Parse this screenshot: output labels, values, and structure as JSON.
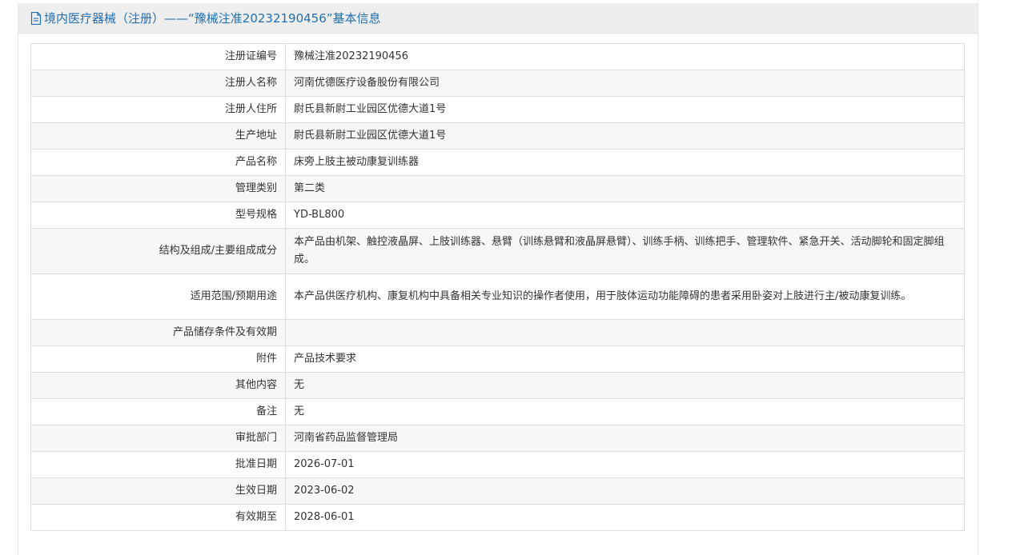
{
  "header": {
    "title": "境内医疗器械（注册）——“豫械注准20232190456”基本信息",
    "icon": "document-icon",
    "color": "#1f6fb2"
  },
  "rows": [
    {
      "label": "注册证编号",
      "value": "豫械注准20232190456"
    },
    {
      "label": "注册人名称",
      "value": "河南优德医疗设备股份有限公司"
    },
    {
      "label": "注册人住所",
      "value": "尉氏县新尉工业园区优德大道1号"
    },
    {
      "label": "生产地址",
      "value": "尉氏县新尉工业园区优德大道1号"
    },
    {
      "label": "产品名称",
      "value": "床旁上肢主被动康复训练器"
    },
    {
      "label": "管理类别",
      "value": "第二类"
    },
    {
      "label": "型号规格",
      "value": "YD-BL800"
    },
    {
      "label": "结构及组成/主要组成成分",
      "value": "本产品由机架、触控液晶屏、上肢训练器、悬臂（训练悬臂和液晶屏悬臂）、训练手柄、训练把手、管理软件、紧急开关、活动脚轮和固定脚组成。"
    },
    {
      "label": "适用范围/预期用途",
      "value": "本产品供医疗机构、康复机构中具备相关专业知识的操作者使用，用于肢体运动功能障碍的患者采用卧姿对上肢进行主/被动康复训练。"
    },
    {
      "label": "产品储存条件及有效期",
      "value": ""
    },
    {
      "label": "附件",
      "value": "产品技术要求"
    },
    {
      "label": "其他内容",
      "value": "无"
    },
    {
      "label": "备注",
      "value": "无"
    },
    {
      "label": "审批部门",
      "value": "河南省药品监督管理局"
    },
    {
      "label": "批准日期",
      "value": "2026-07-01"
    },
    {
      "label": "生效日期",
      "value": "2023-06-02"
    },
    {
      "label": "有效期至",
      "value": "2028-06-01"
    }
  ]
}
